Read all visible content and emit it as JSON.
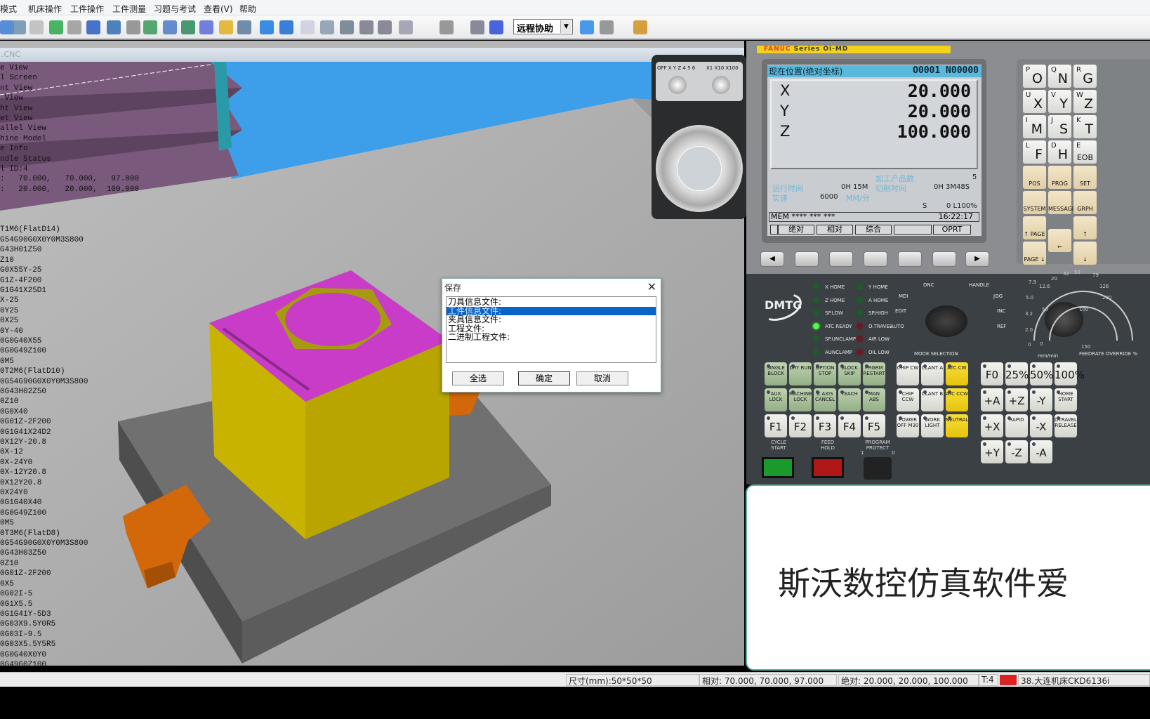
{
  "menu": [
    "模式",
    "机床操作",
    "工件操作",
    "工件测量",
    "习题与考试",
    "查看(V)",
    "帮助"
  ],
  "toolbar": {
    "combo_value": "远程协助",
    "icons": [
      "view-icon",
      "zoom-icon",
      "pan-hand-icon",
      "rotate-icon",
      "select-rect-icon",
      "tool-icon",
      "cube-view-icon",
      "dropdown-icon",
      "workpiece-icon",
      "measure-icon",
      "coolant-icon",
      "cover-icon",
      "star-icon",
      "tool-change-icon",
      "blue-hex-icon",
      "hex-icon",
      "transparent-icon",
      "spindle-icon",
      "length-icon",
      "t-tool-icon",
      "l-tool-icon",
      "magnet-icon",
      "pointer-icon",
      "save-icon",
      "save-as-icon",
      "run-icon",
      "stop-icon",
      "exam-icon"
    ]
  },
  "viewport": {
    "title": ".CNC",
    "overlay_header": [
      "e View",
      "l Screen",
      "nt View",
      " View",
      "ht View",
      "et View",
      "allel View",
      "hine Model",
      "e Info",
      "ndle Status",
      "l ID:4",
      ":   70.000,   70.000,   97.000",
      ":   20.000,   20.000,  100.000"
    ],
    "code": [
      "T1M6(FlatD14)",
      "G54G90G0X0Y0M3S800",
      "G43H01Z50",
      "Z10",
      "G0X55Y-25",
      "G1Z-4F200",
      "G1G41X25D1",
      "X-25",
      "0Y25",
      "0X25",
      "0Y-40",
      "0G0G40X55",
      "0G0G49Z100",
      "0M5",
      "0T2M6(FlatD10)",
      "0G54G90G0X0Y0M3S800",
      "0G43H02Z50",
      "0Z10",
      "0G0X40",
      "0G01Z-2F200",
      "0G1G41X24D2",
      "0X12Y-20.8",
      "0X-12",
      "0X-24Y0",
      "0X-12Y20.8",
      "0X12Y20.8",
      "0X24Y0",
      "0G1G40X40",
      "0G0G49Z100",
      "0M5",
      "0T3M6(FlatD8)",
      "0G54G90G0X0Y0M3S800",
      "0G43H03Z50",
      "0Z10",
      "0G01Z-2F200",
      "0X5",
      "0G02I-5",
      "0G1X5.5",
      "0G1G41Y-5D3",
      "0G03X9.5Y0R5",
      "0G03I-9.5",
      "0G03X5.5Y5R5",
      "0G0G40X0Y0",
      "0G49G0Z100"
    ]
  },
  "dialog": {
    "title": "保存",
    "close": "✕",
    "items": [
      "刀具信息文件:",
      "工件信息文件:",
      "夹具信息文件:",
      "工程文件:",
      "二进制工程文件:"
    ],
    "selected_index": 1,
    "select_all": "全选",
    "ok": "确定",
    "cancel": "取消"
  },
  "fanuc": {
    "series_brand": "FANUC",
    "series": " Series Oi-MD",
    "header": "现在位置(绝对坐标)",
    "program": "O0001 N00000",
    "axes": [
      {
        "name": "X",
        "value": "20.000"
      },
      {
        "name": "Y",
        "value": "20.000"
      },
      {
        "name": "Z",
        "value": "100.000"
      }
    ],
    "parts_label": "加工产品数",
    "parts_count": "5",
    "run_time_label": "运行时间",
    "run_time": "0H 15M",
    "cut_time_label": "切削时间",
    "cut_time": "0H 3M48S",
    "speed_label": "实速",
    "speed": "6000",
    "speed_unit": "MM/分",
    "s_label": "S",
    "s_value": "0 L100%",
    "mode_line": "MEM **** ***    ***",
    "clock": "16:22:17",
    "softkeys": [
      "绝对",
      "相对",
      "综合",
      "",
      "OPRT"
    ]
  },
  "pendant": {
    "axis_labels": [
      "OFF",
      "X",
      "Y",
      "Z",
      "4",
      "5",
      "6"
    ],
    "scale_labels": [
      "X1",
      "X10",
      "X100"
    ]
  },
  "keypad": [
    [
      "P",
      "O"
    ],
    [
      "Q",
      "N"
    ],
    [
      "R",
      "G"
    ],
    [
      "U",
      "X"
    ],
    [
      "V",
      "Y"
    ],
    [
      "W",
      "Z"
    ],
    [
      "I",
      "M"
    ],
    [
      "J",
      "S"
    ],
    [
      "K",
      "T"
    ],
    [
      "L",
      "F"
    ],
    [
      "D",
      "H"
    ],
    [
      "E",
      "EOB"
    ],
    [
      "",
      "POS"
    ],
    [
      "",
      "PROG"
    ],
    [
      "",
      "SET"
    ],
    [
      "",
      "SYSTEM"
    ],
    [
      "",
      "MESSAGE"
    ],
    [
      "",
      "GRPH"
    ],
    [
      "",
      "↑ PAGE"
    ],
    [
      "",
      "←"
    ],
    [
      "",
      "↑"
    ],
    [
      "",
      "PAGE ↓"
    ],
    [
      "",
      "↓"
    ]
  ],
  "panel": {
    "logo": "DMTG",
    "leds": [
      {
        "label": "X HOME",
        "on": false,
        "color": "green"
      },
      {
        "label": "Y HOME",
        "on": false,
        "color": "green"
      },
      {
        "label": "Z HOME",
        "on": false,
        "color": "green"
      },
      {
        "label": "A HOME",
        "on": false,
        "color": "green"
      },
      {
        "label": "SP.LOW",
        "on": false,
        "color": "green"
      },
      {
        "label": "SP.HIGH",
        "on": false,
        "color": "green"
      },
      {
        "label": "ATC READY",
        "on": true,
        "color": "green"
      },
      {
        "label": "O.TRAVEL",
        "on": false,
        "color": "red"
      },
      {
        "label": "SP.UNCLAMP",
        "on": false,
        "color": "green"
      },
      {
        "label": "AIR LOW",
        "on": false,
        "color": "red"
      },
      {
        "label": "AUNCLAMP",
        "on": false,
        "color": "green"
      },
      {
        "label": "OIL LOW",
        "on": false,
        "color": "red"
      }
    ],
    "modes": [
      "DNC",
      "HANDLE",
      "MDI",
      "JOG",
      "EDIT",
      "INC",
      "AUTO",
      "REF"
    ],
    "mode_title": "MODE SELECTION",
    "feed_scale": [
      "0",
      "2.0",
      "3.2",
      "5.0",
      "7.9",
      "12.6",
      "20",
      "32",
      "50",
      "79",
      "126",
      "200"
    ],
    "feed_inner": [
      "0",
      "50",
      "100",
      "150"
    ],
    "feed_unit": "mm/min",
    "feed_title": "FEEDRATE OVERRIDE %",
    "buttons": [
      {
        "label": "SINGLE BLOCK",
        "style": "g"
      },
      {
        "label": "DRY RUN",
        "style": "g"
      },
      {
        "label": "OPTION STOP",
        "style": "g"
      },
      {
        "label": "BLOCK SKIP",
        "style": "g"
      },
      {
        "label": "PRGRM RESTART",
        "style": "g"
      },
      {
        "label": "AUX LOCK",
        "style": "g"
      },
      {
        "label": "MACHINE LOCK",
        "style": "g"
      },
      {
        "label": "Z AXIS CANCEL",
        "style": "g"
      },
      {
        "label": "TEACH",
        "style": "g"
      },
      {
        "label": "MAN ABS",
        "style": "g"
      },
      {
        "label": "F1",
        "style": "w big"
      },
      {
        "label": "F2",
        "style": "w big"
      },
      {
        "label": "F3",
        "style": "w big"
      },
      {
        "label": "F4",
        "style": "w big"
      },
      {
        "label": "F5",
        "style": "w big"
      },
      {
        "label": "CHIP CW",
        "style": "w"
      },
      {
        "label": "CLANT A",
        "style": "w"
      },
      {
        "label": "ATC CW",
        "style": "y"
      },
      {
        "label": "CHIP CCW",
        "style": "w"
      },
      {
        "label": "CLANT B",
        "style": "w"
      },
      {
        "label": "ATC CCW",
        "style": "y"
      },
      {
        "label": "POWER OFF M30",
        "style": "w"
      },
      {
        "label": "WORK LIGHT",
        "style": "w"
      },
      {
        "label": "NEUTRAL",
        "style": "y"
      },
      {
        "label": "F0",
        "style": "w big"
      },
      {
        "label": "25%",
        "style": "w big"
      },
      {
        "label": "50%",
        "style": "w big"
      },
      {
        "label": "100%",
        "style": "w big"
      },
      {
        "label": "+A",
        "style": "w big"
      },
      {
        "label": "+Z",
        "style": "w big"
      },
      {
        "label": "-Y",
        "style": "w big"
      },
      {
        "label": "HOME START",
        "style": "w"
      },
      {
        "label": "+X",
        "style": "w big"
      },
      {
        "label": "RAPID",
        "style": "w"
      },
      {
        "label": "-X",
        "style": "w big"
      },
      {
        "label": "OTRAVEL RELEASE",
        "style": "w"
      },
      {
        "label": "+Y",
        "style": "w big"
      },
      {
        "label": "-Z",
        "style": "w big"
      },
      {
        "label": "-A",
        "style": "w big"
      }
    ],
    "cycle_start": "CYCLE START",
    "feed_hold": "FEED HOLD",
    "program_protect": "PROGRAM PROTECT",
    "protect_marks": [
      "1",
      "0"
    ]
  },
  "watermark": "斯沃数控仿真软件爱",
  "status": {
    "size": "尺寸(mm):50*50*50",
    "relative": "相对:  70.000,  70.000,  97.000",
    "absolute": "绝对:  20.000,  20.000,  100.000",
    "tool": "T:4",
    "machine": "38.大连机床CKD6136i"
  },
  "colors": {
    "sky": "#3d9fea",
    "purple": "#7a5a7c",
    "magenta": "#c83cc8",
    "yellow": "#c8b400",
    "orange": "#d2680a",
    "fanuc_bar": "#f2d21a",
    "screen_header": "#5ab9da",
    "selection": "#0a64c8"
  }
}
